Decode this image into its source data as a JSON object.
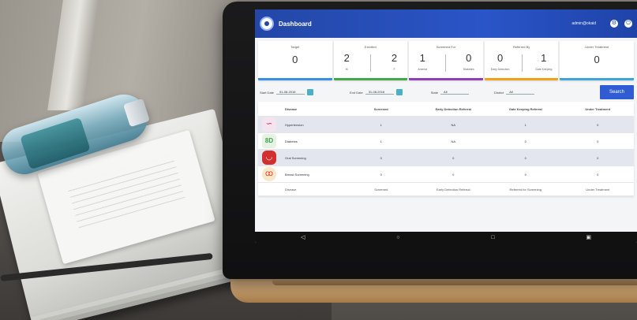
{
  "app": {
    "title": "Dashboard",
    "user": "admin@okaid"
  },
  "stats": [
    {
      "kind": "single",
      "title": "Target",
      "value": "0",
      "color": "#3a8ee6"
    },
    {
      "kind": "pair",
      "title": "Enrolled",
      "a_value": "2",
      "a_label": "M",
      "b_value": "2",
      "b_label": "F",
      "color": "#42a845"
    },
    {
      "kind": "pair",
      "title": "Screened For",
      "a_value": "1",
      "a_label": "Anemia",
      "b_value": "0",
      "b_label": "Diabetes",
      "color": "#8e3fb8"
    },
    {
      "kind": "pair",
      "title": "Referred By",
      "a_value": "0",
      "a_label": "Early Detection",
      "b_value": "1",
      "b_label": "Gate Keeping",
      "color": "#f0a21f"
    },
    {
      "kind": "single",
      "title": "Under Treatment",
      "value": "0",
      "color": "#3aa6d9"
    }
  ],
  "filters": {
    "start_label": "Start Date",
    "start_value": "01-08-2016",
    "end_label": "End Date",
    "end_value": "31-08-2016",
    "state_label": "State",
    "state_value": "All",
    "district_label": "District",
    "district_value": "All",
    "search_label": "Search"
  },
  "table": {
    "headers": [
      "Disease",
      "Screened",
      "Early Detection Referral",
      "Gate Keeping Referral",
      "Under Treatment"
    ],
    "rows": [
      {
        "name": "Hypertension",
        "values": [
          "1",
          "NA",
          "1",
          "0"
        ],
        "icon": "stethoscope-icon",
        "icon_color": "#c2185b",
        "icon_bg": "#f3e4ee",
        "alt": true
      },
      {
        "name": "Diabetes",
        "values": [
          "1",
          "NA",
          "0",
          "0"
        ],
        "icon": "glucose-icon",
        "icon_color": "#43a047",
        "icon_bg": "#e6f3e4",
        "alt": false
      },
      {
        "name": "Oral Screening",
        "values": [
          "0",
          "0",
          "0",
          "0"
        ],
        "icon": "mouth-icon",
        "icon_color": "#ffffff",
        "icon_bg": "#d32f2f",
        "alt": true
      },
      {
        "name": "Breast Screening",
        "values": [
          "0",
          "0",
          "0",
          "0"
        ],
        "icon": "ribbon-icon",
        "icon_color": "#e53935",
        "icon_bg": "#f6e9c8",
        "alt": false
      }
    ],
    "footer": [
      "Disease",
      "Screened",
      "Early Detection Referral",
      "Referred for Screening",
      "Under Treatment"
    ]
  },
  "nav": {
    "back": "◁",
    "home": "○",
    "recents": "□",
    "menu": "▣"
  }
}
